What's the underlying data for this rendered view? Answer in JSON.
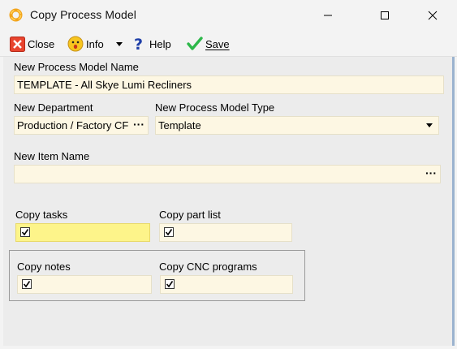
{
  "window": {
    "title": "Copy Process Model"
  },
  "toolbar": {
    "close_label": "Close",
    "info_label": "Info",
    "help_label": "Help",
    "save_label": "Save"
  },
  "form": {
    "model_name": {
      "label": "New Process Model Name",
      "value": "TEMPLATE - All Skye Lumi Recliners"
    },
    "department": {
      "label": "New Department",
      "value": "Production / Factory CF"
    },
    "model_type": {
      "label": "New Process Model Type",
      "value": "Template"
    },
    "item_name": {
      "label": "New Item Name",
      "value": ""
    },
    "copy_tasks": {
      "label": "Copy tasks",
      "checked": true
    },
    "copy_part_list": {
      "label": "Copy part list",
      "checked": true
    },
    "copy_notes": {
      "label": "Copy notes",
      "checked": true
    },
    "copy_cnc": {
      "label": "Copy CNC programs",
      "checked": true
    }
  },
  "colors": {
    "field_bg": "#fdf7e3",
    "field_focus_bg": "#fdf48a",
    "close_icon": "#e8442e",
    "save_icon": "#2db84a",
    "info_icon": "#f7c51e"
  }
}
